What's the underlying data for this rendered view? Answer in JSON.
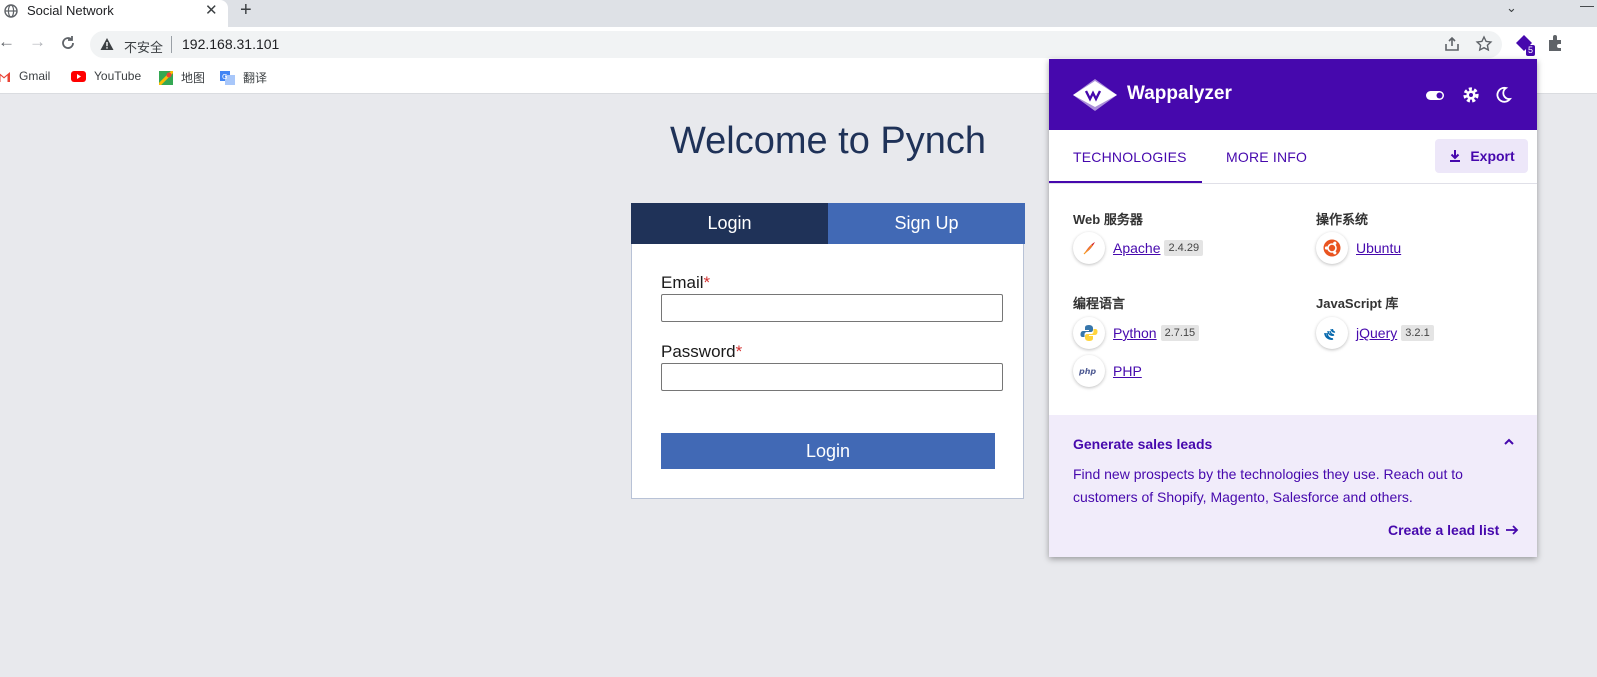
{
  "browser": {
    "tab_title": "Social Network",
    "security_label": "不安全",
    "url": "192.168.31.101",
    "extension_badge": "5",
    "bookmarks": [
      {
        "label": "Gmail",
        "icon": "gmail-icon"
      },
      {
        "label": "YouTube",
        "icon": "youtube-icon"
      },
      {
        "label": "地图",
        "icon": "maps-icon"
      },
      {
        "label": "翻译",
        "icon": "translate-icon"
      }
    ]
  },
  "page": {
    "heading": "Welcome to Pynch",
    "tabs": {
      "login": "Login",
      "signup": "Sign Up"
    },
    "email_label": "Email",
    "password_label": "Password",
    "required_mark": "*",
    "submit_label": "Login"
  },
  "wappalyzer": {
    "brand": "Wappalyzer",
    "tabs": [
      "TECHNOLOGIES",
      "MORE INFO"
    ],
    "export_label": "Export",
    "categories": [
      {
        "title": "Web 服务器",
        "items": [
          {
            "name": "Apache",
            "version": "2.4.29",
            "icon": "apache-icon"
          }
        ]
      },
      {
        "title": "操作系统",
        "items": [
          {
            "name": "Ubuntu",
            "version": "",
            "icon": "ubuntu-icon"
          }
        ]
      },
      {
        "title": "编程语言",
        "items": [
          {
            "name": "Python",
            "version": "2.7.15",
            "icon": "python-icon"
          },
          {
            "name": "PHP",
            "version": "",
            "icon": "php-icon"
          }
        ]
      },
      {
        "title": "JavaScript 库",
        "items": [
          {
            "name": "jQuery",
            "version": "3.2.1",
            "icon": "jquery-icon"
          }
        ]
      }
    ],
    "leads": {
      "title": "Generate sales leads",
      "text": "Find new prospects by the technologies they use. Reach out to customers of Shopify, Magento, Salesforce and others.",
      "link": "Create a lead list"
    },
    "colors": {
      "brand": "#4608ad",
      "leads_bg": "#f1ecfa"
    }
  },
  "colors": {
    "page_bg": "#e8e9ed",
    "heading": "#1f3258",
    "login_tab": "#1f3258",
    "signup_tab": "#4169b5"
  }
}
